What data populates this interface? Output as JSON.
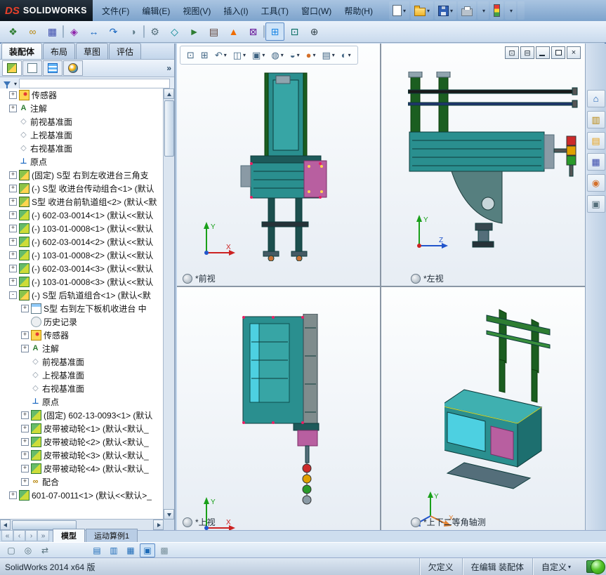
{
  "glyphs": {
    "caret": "▾",
    "overflow": "»",
    "close": "×"
  },
  "brand": {
    "mark": "DS",
    "name": "SOLIDWORKS"
  },
  "menus": [
    {
      "label": "文件(F)"
    },
    {
      "label": "编辑(E)"
    },
    {
      "label": "视图(V)"
    },
    {
      "label": "插入(I)"
    },
    {
      "label": "工具(T)"
    },
    {
      "label": "窗口(W)"
    },
    {
      "label": "帮助(H)"
    }
  ],
  "quick_toolbar": [
    {
      "name": "new-document-button",
      "icon": "page",
      "caret": true
    },
    {
      "name": "open-button",
      "icon": "folder",
      "caret": true
    },
    {
      "name": "save-button",
      "icon": "save",
      "caret": true
    },
    {
      "name": "print-button",
      "icon": "print"
    },
    {
      "name": "undo-button",
      "icon": "undo",
      "caret": true
    },
    {
      "name": "rebuild-button",
      "icon": "traffic"
    },
    {
      "name": "options-button",
      "icon": "gear",
      "caret": true
    },
    {
      "name": "help-button",
      "icon": "help"
    }
  ],
  "main_toolbar": [
    {
      "name": "insert-components-button",
      "glyph": "❖",
      "color": "#2e7d32"
    },
    {
      "name": "mate-button",
      "glyph": "∞",
      "color": "#b8860b"
    },
    {
      "name": "linear-component-pattern-button",
      "glyph": "▦",
      "color": "#3949ab"
    },
    {
      "name": "separator",
      "sep": true,
      "it": false
    },
    {
      "name": "smart-fasteners-button",
      "glyph": "◈",
      "color": "#8e24aa"
    },
    {
      "name": "move-component-button",
      "glyph": "↔",
      "color": "#1565c0"
    },
    {
      "name": "rotate-component-button",
      "glyph": "↷",
      "color": "#1565c0"
    },
    {
      "name": "show-hidden-components-button",
      "glyph": "◑",
      "color": "#607d8b"
    },
    {
      "name": "separator",
      "sep": true,
      "it": false
    },
    {
      "name": "assembly-features-button",
      "glyph": "⚙",
      "color": "#546e7a"
    },
    {
      "name": "reference-geometry-button",
      "glyph": "◇",
      "color": "#00838f"
    },
    {
      "name": "new-motion-study-button",
      "glyph": "►",
      "color": "#2e7d32"
    },
    {
      "name": "bill-of-materials-button",
      "glyph": "▤",
      "color": "#5d4037"
    },
    {
      "name": "exploded-view-button",
      "glyph": "▲",
      "color": "#ef6c00"
    },
    {
      "name": "interference-detection-button",
      "glyph": "⊠",
      "color": "#6a1b9a"
    },
    {
      "name": "separator",
      "sep": true,
      "it": false
    },
    {
      "name": "multi-viewport-button",
      "glyph": "⊞",
      "color": "#1e88e5",
      "active": true
    },
    {
      "name": "measure-button",
      "glyph": "⊡",
      "color": "#00695c"
    },
    {
      "name": "mass-properties-button",
      "glyph": "⊕",
      "color": "#37474f"
    }
  ],
  "command_tabs": [
    {
      "label": "装配体",
      "active": true
    },
    {
      "label": "布局"
    },
    {
      "label": "草图"
    },
    {
      "label": "评估"
    }
  ],
  "fm_tabs": [
    {
      "name": "featuremanager-tree-tab",
      "icon": "tree",
      "active": true
    },
    {
      "name": "propertymanager-tab",
      "icon": "sheet"
    },
    {
      "name": "configurationmanager-tab",
      "icon": "stack"
    },
    {
      "name": "displaymanager-tab",
      "icon": "ball"
    }
  ],
  "tree": [
    {
      "exp": "+",
      "icon": "sensor",
      "label": "传感器"
    },
    {
      "exp": "+",
      "icon": "annot",
      "ig": "A",
      "label": "注解"
    },
    {
      "icon": "plane",
      "ig": "◇",
      "label": "前视基准面"
    },
    {
      "icon": "plane",
      "ig": "◇",
      "label": "上视基准面"
    },
    {
      "icon": "plane",
      "ig": "◇",
      "label": "右视基准面"
    },
    {
      "icon": "origin",
      "ig": "⊥",
      "label": "原点"
    },
    {
      "exp": "+",
      "icon": "asm",
      "label": "(固定) S型 右到左收进台三角支"
    },
    {
      "exp": "+",
      "icon": "asm",
      "label": "(-) S型 收进台传动组合<1> (默认"
    },
    {
      "exp": "+",
      "icon": "asm",
      "label": "S型 收进台前轨道组<2> (默认<默"
    },
    {
      "exp": "+",
      "icon": "part",
      "label": "(-) 602-03-0014<1> (默认<<默认"
    },
    {
      "exp": "+",
      "icon": "part",
      "label": "(-) 103-01-0008<1> (默认<<默认"
    },
    {
      "exp": "+",
      "icon": "part",
      "label": "(-) 602-03-0014<2> (默认<<默认"
    },
    {
      "exp": "+",
      "icon": "part",
      "label": "(-) 103-01-0008<2> (默认<<默认"
    },
    {
      "exp": "+",
      "icon": "part",
      "label": "(-) 602-03-0014<3> (默认<<默认"
    },
    {
      "exp": "+",
      "icon": "part",
      "label": "(-) 103-01-0008<3> (默认<<默认"
    },
    {
      "exp": "-",
      "icon": "asm",
      "label": "(-) S型 后轨道组合<1> (默认<默"
    },
    {
      "exp": "+",
      "icon": "part2",
      "label": "S型 右到左下板机收进台 中",
      "lvl2": true
    },
    {
      "icon": "hist",
      "label": "历史记录",
      "lvl2": true
    },
    {
      "exp": "+",
      "icon": "sensor",
      "label": "传感器",
      "lvl2": true
    },
    {
      "exp": "+",
      "icon": "annot",
      "ig": "A",
      "label": "注解",
      "lvl2": true
    },
    {
      "icon": "plane",
      "ig": "◇",
      "label": "前视基准面",
      "lvl2": true
    },
    {
      "icon": "plane",
      "ig": "◇",
      "label": "上视基准面",
      "lvl2": true
    },
    {
      "icon": "plane",
      "ig": "◇",
      "label": "右视基准面",
      "lvl2": true
    },
    {
      "icon": "origin",
      "ig": "⊥",
      "label": "原点",
      "lvl2": true
    },
    {
      "exp": "+",
      "icon": "part",
      "label": "(固定) 602-13-0093<1> (默认",
      "lvl2": true
    },
    {
      "exp": "+",
      "icon": "part",
      "label": "皮带被动轮<1> (默认<默认_",
      "lvl2": true
    },
    {
      "exp": "+",
      "icon": "part",
      "label": "皮带被动轮<2> (默认<默认_",
      "lvl2": true
    },
    {
      "exp": "+",
      "icon": "part",
      "label": "皮带被动轮<3> (默认<默认_",
      "lvl2": true
    },
    {
      "exp": "+",
      "icon": "part",
      "label": "皮带被动轮<4> (默认<默认_",
      "lvl2": true
    },
    {
      "exp": "+",
      "icon": "mates",
      "ig": "∞",
      "label": "配合",
      "lvl2": true
    },
    {
      "exp": "+",
      "icon": "part",
      "label": "601-07-0011<1> (默认<<默认>_"
    }
  ],
  "headsup": [
    {
      "name": "zoom-fit-button",
      "glyph": "⊡"
    },
    {
      "name": "zoom-area-button",
      "glyph": "⊞"
    },
    {
      "name": "previous-view-button",
      "glyph": "↶",
      "caret": true
    },
    {
      "name": "section-view-button",
      "glyph": "◫",
      "caret": true
    },
    {
      "name": "view-orientation-button",
      "glyph": "▣",
      "caret": true
    },
    {
      "name": "display-style-button",
      "glyph": "◍",
      "caret": true
    },
    {
      "name": "hide-show-items-button",
      "glyph": "◒",
      "caret": true
    },
    {
      "name": "edit-appearance-button",
      "glyph": "●",
      "color": "#d4702a",
      "caret": true
    },
    {
      "name": "apply-scene-button",
      "glyph": "▤",
      "caret": true
    },
    {
      "name": "view-settings-button",
      "glyph": "◐",
      "caret": true
    }
  ],
  "window_buttons": [
    {
      "name": "viewport-layout-button",
      "glyph": "⊡"
    },
    {
      "name": "viewport-split-button",
      "glyph": "⊟"
    }
  ],
  "taskpane": [
    {
      "name": "solidworks-resources-button",
      "glyph": "⌂",
      "color": "#1a5fb4"
    },
    {
      "name": "design-library-button",
      "glyph": "▥",
      "color": "#b8860b"
    },
    {
      "name": "file-explorer-button",
      "glyph": "▤",
      "color": "#e8a117"
    },
    {
      "name": "view-palette-button",
      "glyph": "▦",
      "color": "#3949ab"
    },
    {
      "name": "appearances-scenes-button",
      "glyph": "◉",
      "color": "#d4702a"
    },
    {
      "name": "custom-properties-button",
      "glyph": "▣",
      "color": "#546e7a"
    }
  ],
  "views": {
    "front": {
      "label": "*前视"
    },
    "left": {
      "label": "*左视"
    },
    "top": {
      "label": "*上视"
    },
    "iso": {
      "label": "*上下二等角轴测"
    }
  },
  "triad": {
    "x": "X",
    "y": "Y",
    "z": "Z"
  },
  "doc_tabs": {
    "nav": [
      {
        "name": "first-tab-button",
        "glyph": "«"
      },
      {
        "name": "prev-tab-button",
        "glyph": "‹"
      },
      {
        "name": "next-tab-button",
        "glyph": "›"
      },
      {
        "name": "last-tab-button",
        "glyph": "»"
      }
    ],
    "tabs": [
      {
        "label": "模型",
        "active": true
      },
      {
        "label": "运动算例1"
      }
    ]
  },
  "bottom_toolbar": [
    {
      "name": "select-button",
      "glyph": "▢",
      "color": "#546e7a"
    },
    {
      "name": "zoom-button",
      "glyph": "◎",
      "color": "#546e7a"
    },
    {
      "name": "pan-button",
      "glyph": "⇄",
      "color": "#546e7a"
    },
    {
      "name": "spacer",
      "spacer": true,
      "it": false
    },
    {
      "name": "wireframe-display-button",
      "glyph": "▤",
      "color": "#1e6bb8"
    },
    {
      "name": "hidden-lines-button",
      "glyph": "▥",
      "color": "#1e6bb8"
    },
    {
      "name": "shaded-edges-button",
      "glyph": "▦",
      "color": "#1e6bb8"
    },
    {
      "name": "shaded-display-button",
      "glyph": "▣",
      "color": "#1e6bb8",
      "active": true
    },
    {
      "name": "draft-quality-button",
      "glyph": "▩",
      "color": "#78909c"
    }
  ],
  "status": {
    "left": "SolidWorks 2014 x64 版",
    "help": "?",
    "items": [
      {
        "label": "欠定义",
        "interactable": false
      },
      {
        "label": "在编辑 装配体",
        "interactable": false
      },
      {
        "label": "自定义",
        "caret": true,
        "interactable": true
      }
    ]
  }
}
